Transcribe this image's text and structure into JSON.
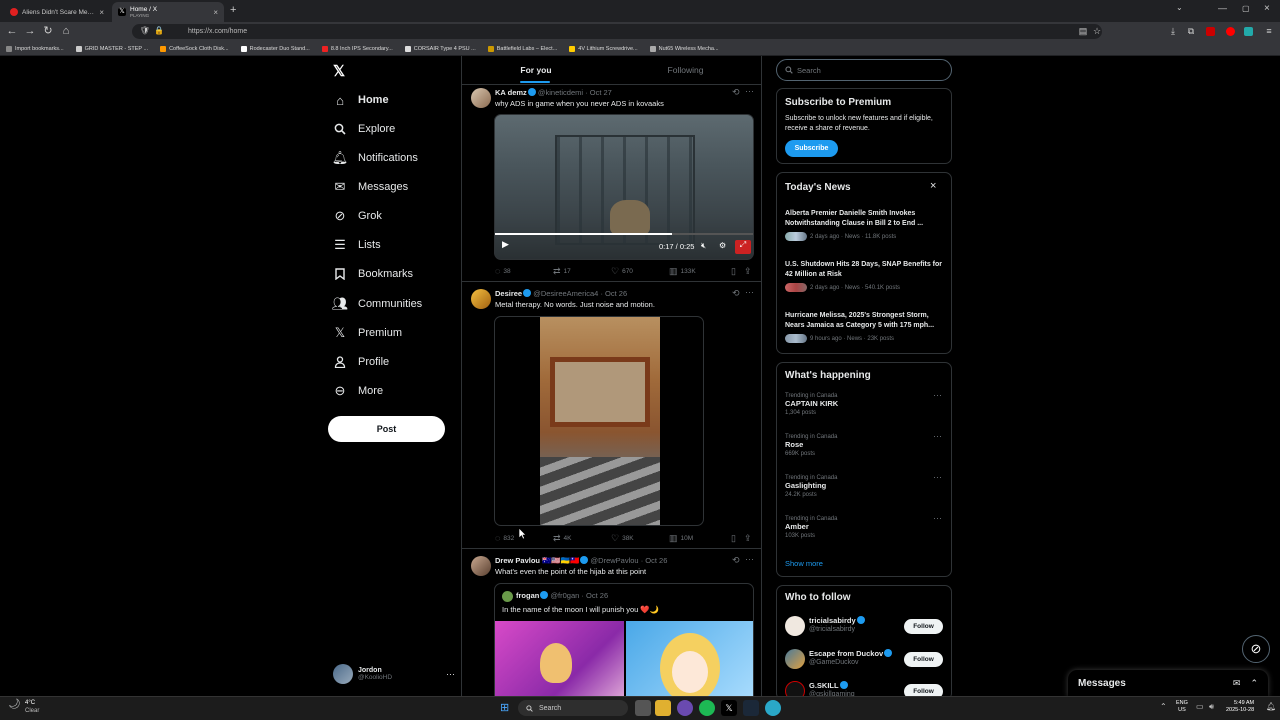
{
  "browser": {
    "tabs": [
      {
        "title": "Aliens Didn't Scare Me Until I L..."
      },
      {
        "title": "Home / X",
        "subtitle": "PLAYING"
      }
    ],
    "url": "https://x.com/home",
    "bookmarks": [
      "Import bookmarks...",
      "GRID MASTER - STEP ...",
      "CoffeeSock Cloth Disk...",
      "Rodecaster Duo Stand...",
      "8.8 Inch IPS Secondary...",
      "CORSAIR Type 4 PSU ...",
      "Battlefield Labs – Elect...",
      "4V Lithium Screwdrive...",
      "Nut65 Wireless Mecha..."
    ]
  },
  "nav": {
    "items": [
      {
        "label": "Home",
        "icon": "home-icon"
      },
      {
        "label": "Explore",
        "icon": "search-icon"
      },
      {
        "label": "Notifications",
        "icon": "bell-icon"
      },
      {
        "label": "Messages",
        "icon": "envelope-icon"
      },
      {
        "label": "Grok",
        "icon": "grok-icon"
      },
      {
        "label": "Lists",
        "icon": "list-icon"
      },
      {
        "label": "Bookmarks",
        "icon": "bookmark-icon"
      },
      {
        "label": "Communities",
        "icon": "people-icon"
      },
      {
        "label": "Premium",
        "icon": "x-logo-icon"
      },
      {
        "label": "Profile",
        "icon": "person-icon"
      },
      {
        "label": "More",
        "icon": "more-circle-icon"
      }
    ],
    "post_label": "Post",
    "user": {
      "name": "Jordon",
      "handle": "@KoolioHD"
    }
  },
  "feed": {
    "tabs": [
      "For you",
      "Following"
    ],
    "tweets": [
      {
        "name": "KA demz",
        "handle": "@kineticdemi",
        "date": "Oct 27",
        "text": "why ADS in game when you never ADS in kovaaks",
        "video_time": "0:17 / 0:25",
        "replies": "38",
        "reposts": "17",
        "likes": "670",
        "views": "133K"
      },
      {
        "name": "Desiree",
        "handle": "@DesireeAmerica4",
        "date": "Oct 26",
        "text": "Metal therapy. No words. Just noise and motion.",
        "replies": "832",
        "reposts": "4K",
        "likes": "38K",
        "views": "10M"
      },
      {
        "name": "Drew Pavlou 🇦🇺🇺🇸🇺🇦🇹🇼",
        "handle": "@DrewPavlou",
        "date": "Oct 26",
        "text": "What's even the point of the hijab at this point",
        "quote": {
          "name": "frogan",
          "handle": "@fr0gan",
          "date": "Oct 26",
          "text": "In the name of the moon I will punish you ❤️🌙"
        }
      }
    ]
  },
  "right": {
    "search_placeholder": "Search",
    "premium": {
      "title": "Subscribe to Premium",
      "body": "Subscribe to unlock new features and if eligible, receive a share of revenue.",
      "button": "Subscribe"
    },
    "news": {
      "title": "Today's News",
      "items": [
        {
          "headline": "Alberta Premier Danielle Smith Invokes Notwithstanding Clause in Bill 2 to End ...",
          "meta": "2 days ago · News · 11.8K posts"
        },
        {
          "headline": "U.S. Shutdown Hits 28 Days, SNAP Benefits for 42 Million at Risk",
          "meta": "2 days ago · News · 540.1K posts"
        },
        {
          "headline": "Hurricane Melissa, 2025's Strongest Storm, Nears Jamaica as Category 5 with 175 mph...",
          "meta": "9 hours ago · News · 23K posts"
        }
      ]
    },
    "happening": {
      "title": "What's happening",
      "items": [
        {
          "context": "Trending in Canada",
          "name": "CAPTAIN KIRK",
          "posts": "1,304 posts"
        },
        {
          "context": "Trending in Canada",
          "name": "Rose",
          "posts": "669K posts"
        },
        {
          "context": "Trending in Canada",
          "name": "Gaslighting",
          "posts": "24.2K posts"
        },
        {
          "context": "Trending in Canada",
          "name": "Amber",
          "posts": "103K posts"
        }
      ],
      "show_more": "Show more"
    },
    "follow": {
      "title": "Who to follow",
      "button": "Follow",
      "items": [
        {
          "name": "tricialsabirdy",
          "handle": "@tricialsabirdy"
        },
        {
          "name": "Escape from Duckov",
          "handle": "@GameDuckov"
        },
        {
          "name": "G.SKILL",
          "handle": "@gskillgaming"
        }
      ]
    },
    "messages_drawer": "Messages"
  },
  "taskbar": {
    "weather_temp": "4°C",
    "weather_text": "Clear",
    "search": "Search",
    "lang": "ENG",
    "region": "US",
    "time": "5:49 AM",
    "date": "2025-10-28"
  },
  "colors": {
    "accent": "#1d9bf0",
    "background": "#000000",
    "border": "#2f3336",
    "muted": "#71767b"
  }
}
